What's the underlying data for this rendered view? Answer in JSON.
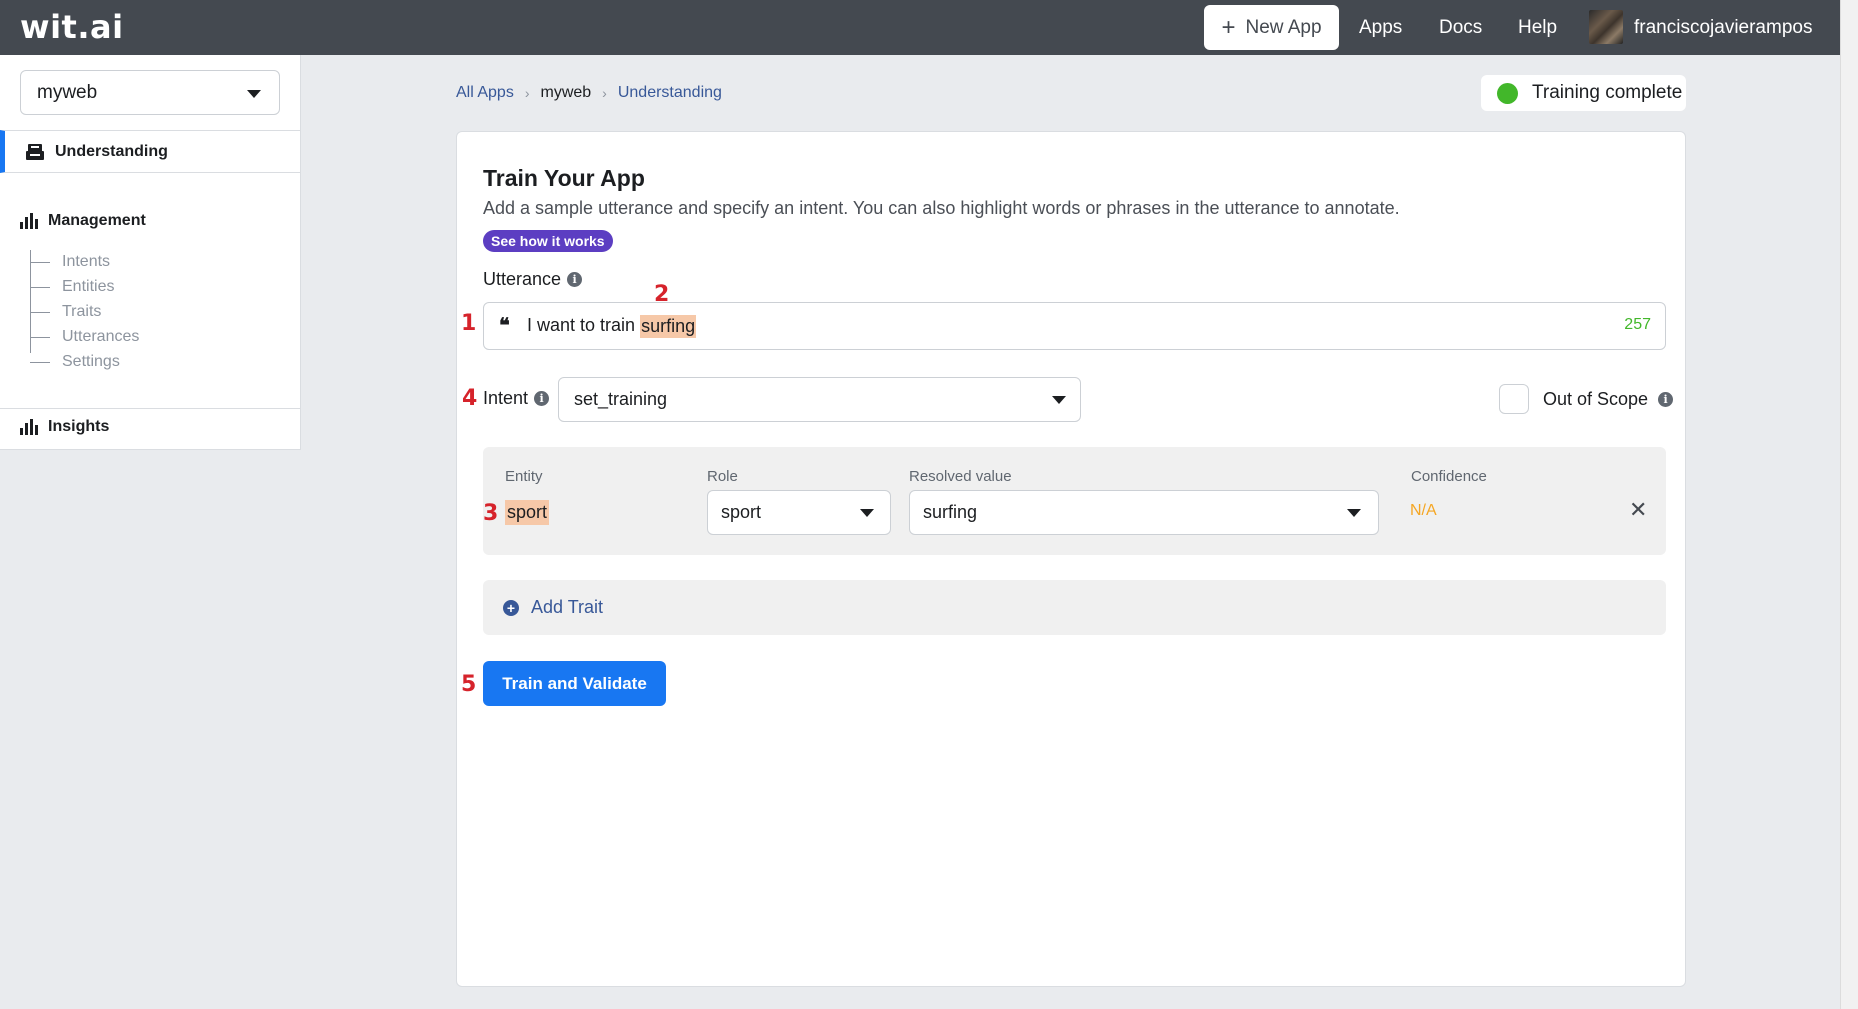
{
  "header": {
    "logo": "wit.ai",
    "new_app_label": "New App",
    "nav": [
      "Apps",
      "Docs",
      "Help"
    ],
    "username": "franciscojavierampos"
  },
  "sidebar": {
    "app_name": "myweb",
    "understanding": "Understanding",
    "management": "Management",
    "management_items": [
      "Intents",
      "Entities",
      "Traits",
      "Utterances",
      "Settings"
    ],
    "insights": "Insights"
  },
  "breadcrumb": [
    "All Apps",
    "myweb",
    "Understanding"
  ],
  "status": {
    "label": "Training complete",
    "color": "#42b72a"
  },
  "main": {
    "title": "Train Your App",
    "description": "Add a sample utterance and specify an intent. You can also highlight words or phrases in the utterance to annotate.",
    "how_it_works": "See how it works",
    "utterance_label": "Utterance",
    "utterance_quote": "❝",
    "utterance_text": "I want to train",
    "utterance_highlight": "surfing",
    "char_count": "257",
    "intent_label": "Intent",
    "intent_value": "set_training",
    "out_of_scope_label": "Out of Scope",
    "entity": {
      "headers": {
        "entity": "Entity",
        "role": "Role",
        "resolved": "Resolved value",
        "confidence": "Confidence"
      },
      "name": "sport",
      "role": "sport",
      "resolved": "surfing",
      "confidence": "N/A"
    },
    "add_trait": "Add Trait",
    "train_button": "Train and Validate"
  },
  "markers": [
    "1",
    "2",
    "3",
    "4",
    "5"
  ],
  "colors": {
    "accent": "#1877f2",
    "topbar": "#444950",
    "highlight": "#f6c8a8",
    "marker": "#d6232b",
    "purple": "#5c3ec2"
  }
}
